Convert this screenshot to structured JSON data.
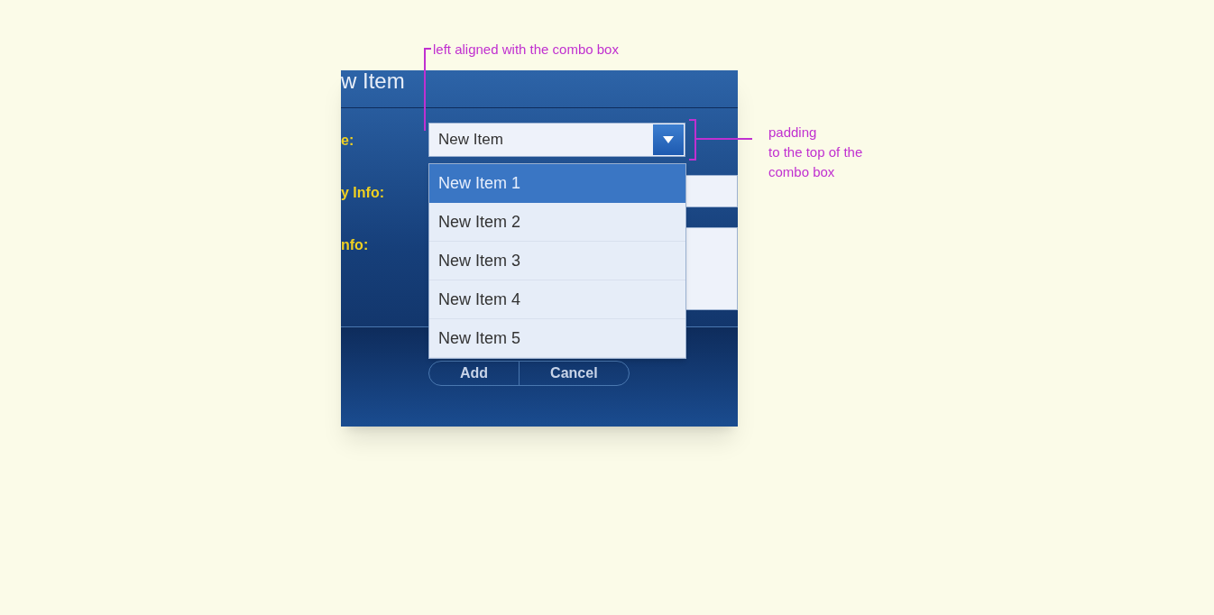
{
  "dialog": {
    "title": "w Item",
    "fields": [
      {
        "label": "e:",
        "kind": "combo",
        "value": "New Item",
        "expanded": true
      },
      {
        "label": "y Info:",
        "kind": "text"
      },
      {
        "label": "nfo:",
        "kind": "textarea"
      }
    ],
    "dropdown": [
      {
        "label": "New Item 1",
        "selected": true
      },
      {
        "label": "New Item 2",
        "selected": false
      },
      {
        "label": "New Item 3",
        "selected": false
      },
      {
        "label": "New Item 4",
        "selected": false
      },
      {
        "label": "New Item 5",
        "selected": false
      }
    ],
    "buttons": [
      "Add",
      "Cancel"
    ]
  },
  "annotations": [
    {
      "kind": "top",
      "lines": [
        "left aligned with the combo box"
      ]
    },
    {
      "kind": "side",
      "lines": [
        "padding",
        "to the top of the",
        "combo box"
      ]
    }
  ]
}
